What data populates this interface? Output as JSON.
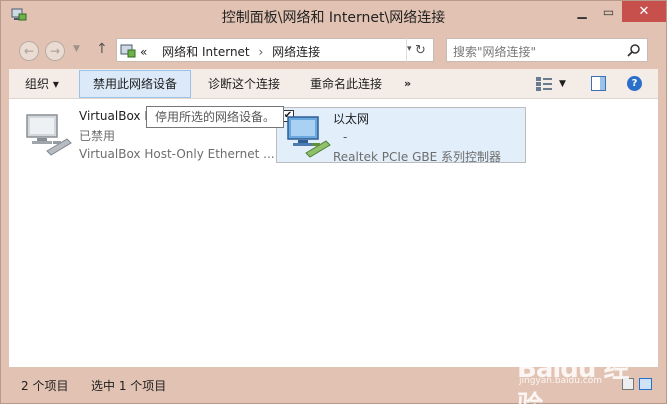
{
  "window": {
    "title": "控制面板\\网络和 Internet\\网络连接"
  },
  "nav": {
    "breadcrumb_prefix": "«",
    "breadcrumb": [
      "网络和 Internet",
      "网络连接"
    ],
    "breadcrumb_sep": "›",
    "search_placeholder": "搜索\"网络连接\""
  },
  "toolbar": {
    "organize": "组织 ▾",
    "disable": "禁用此网络设备",
    "diagnose": "诊断这个连接",
    "rename": "重命名此连接",
    "more": "»"
  },
  "items": [
    {
      "name": "VirtualBox H",
      "status": "已禁用",
      "device": "VirtualBox Host-Only Ethernet ..."
    },
    {
      "name": "以太网",
      "status": "-",
      "device": "Realtek PCIe GBE 系列控制器",
      "checked": "✔"
    }
  ],
  "tooltip": "停用所选的网络设备。",
  "status": {
    "count": "2 个项目",
    "selected": "选中 1 个项目"
  },
  "watermark": {
    "logo": "Baidu 经验",
    "url": "jingyan.baidu.com"
  },
  "colors": {
    "close_button": "#c7504d",
    "selection": "#e2eef9",
    "toolbar_highlight": "#dbe9f8"
  }
}
